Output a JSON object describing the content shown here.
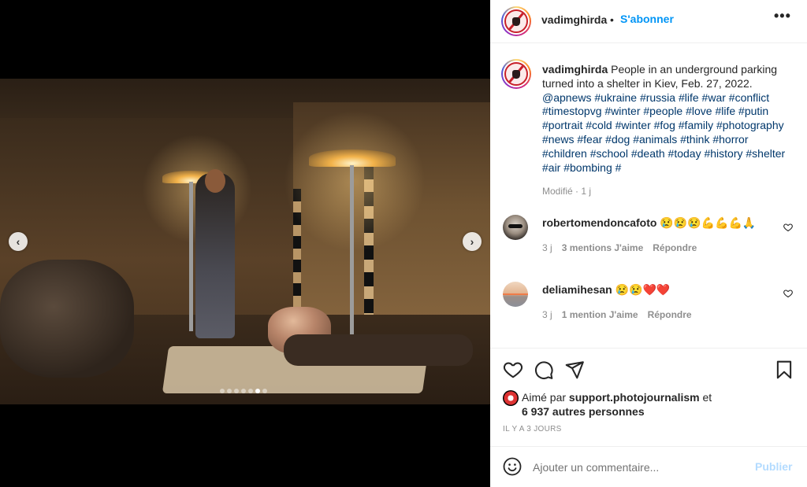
{
  "post": {
    "carousel": {
      "dots_total": 7,
      "active_index": 5,
      "prev_label": "‹",
      "next_label": "›"
    },
    "header": {
      "username": "vadimghirda",
      "separator": "•",
      "follow_label": "S'abonner",
      "more_label": "•••"
    },
    "caption": {
      "username": "vadimghirda",
      "text": "People in an underground parking turned into a shelter in Kiev, Feb. 27, 2022.",
      "hashtags": "@apnews #ukraine #russia #life #war #conflict #timestopvg #winter #people #love #life #putin #portrait #cold #winter #fog #family #photography #news #fear #dog #animals #think #horror #children #school #death #today #history #shelter #air #bombing #",
      "modified": "Modifié · 1 j"
    },
    "comments": [
      {
        "username": "robertomendoncafoto",
        "text": "😢😢😢💪💪💪🙏",
        "age": "3 j",
        "likes": "3 mentions J'aime",
        "reply": "Répondre"
      },
      {
        "username": "deliamihesan",
        "text": "😢😢❤️❤️",
        "age": "3 j",
        "likes": "1 mention J'aime",
        "reply": "Répondre"
      }
    ],
    "icons": {
      "like": "heart-icon",
      "comment": "comment-icon",
      "share": "share-icon",
      "save": "bookmark-icon",
      "emoji": "emoji-icon",
      "comment_like": "heart-outline-icon"
    },
    "likes": {
      "prefix": "Aimé par",
      "user": "support.photojournalism",
      "suffix": "et",
      "others": "6 937 autres personnes"
    },
    "time_ago": "IL Y A 3 JOURS",
    "add_comment": {
      "placeholder": "Ajouter un commentaire...",
      "value": "",
      "publish_label": "Publier"
    },
    "colors": {
      "accent": "#0095f6",
      "link": "#00376b",
      "muted": "#8e8e8e",
      "publish_disabled": "#b3dbff"
    }
  }
}
